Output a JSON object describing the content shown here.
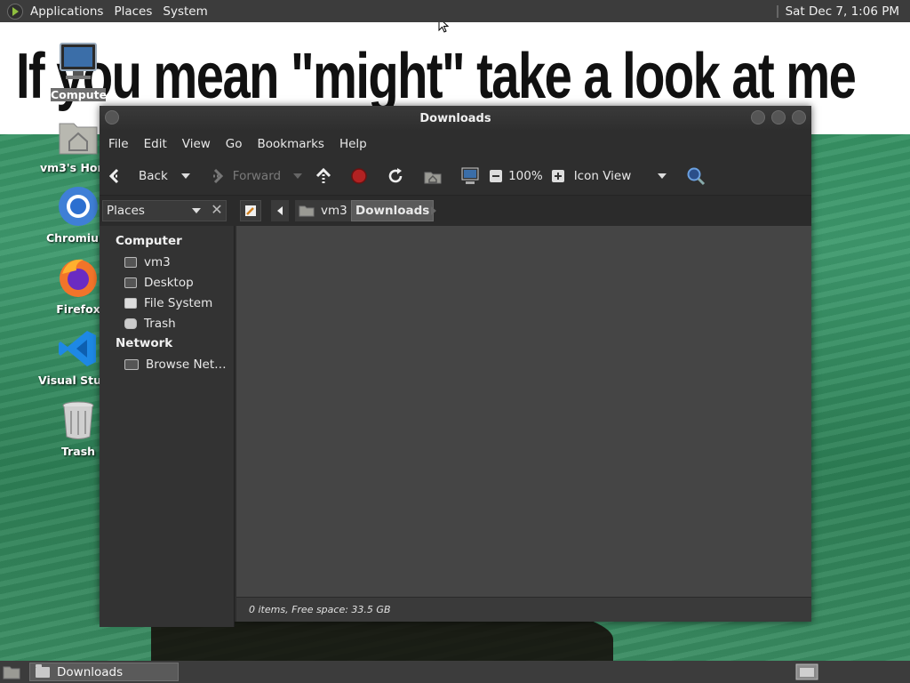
{
  "top_panel": {
    "applications": "Applications",
    "places": "Places",
    "system": "System",
    "clock": "Sat Dec 7, 1:06 PM"
  },
  "desktop": {
    "banner_text": "If you mean \"might\" take a look at me",
    "icons": [
      {
        "label": "Computer",
        "icon": "computer-icon"
      },
      {
        "label": "vm3's Home",
        "icon": "home-folder-icon"
      },
      {
        "label": "Chromium",
        "icon": "chromium-icon"
      },
      {
        "label": "Firefox",
        "icon": "firefox-icon"
      },
      {
        "label": "Visual Studio Code",
        "icon": "vscode-icon"
      },
      {
        "label": "Trash",
        "icon": "trash-icon"
      }
    ]
  },
  "window": {
    "title": "Downloads",
    "menu": [
      "File",
      "Edit",
      "View",
      "Go",
      "Bookmarks",
      "Help"
    ],
    "toolbar": {
      "back": "Back",
      "forward": "Forward",
      "zoom": "100%",
      "view_mode": "Icon View"
    },
    "sidebar_combo": "Places",
    "path": [
      "vm3",
      "Downloads"
    ],
    "sidebar": {
      "computer_heading": "Computer",
      "computer_items": [
        "vm3",
        "Desktop",
        "File System",
        "Trash"
      ],
      "network_heading": "Network",
      "network_items": [
        "Browse Net…"
      ]
    },
    "status": "0 items, Free space: 33.5 GB"
  },
  "bottom_panel": {
    "task": "Downloads"
  }
}
